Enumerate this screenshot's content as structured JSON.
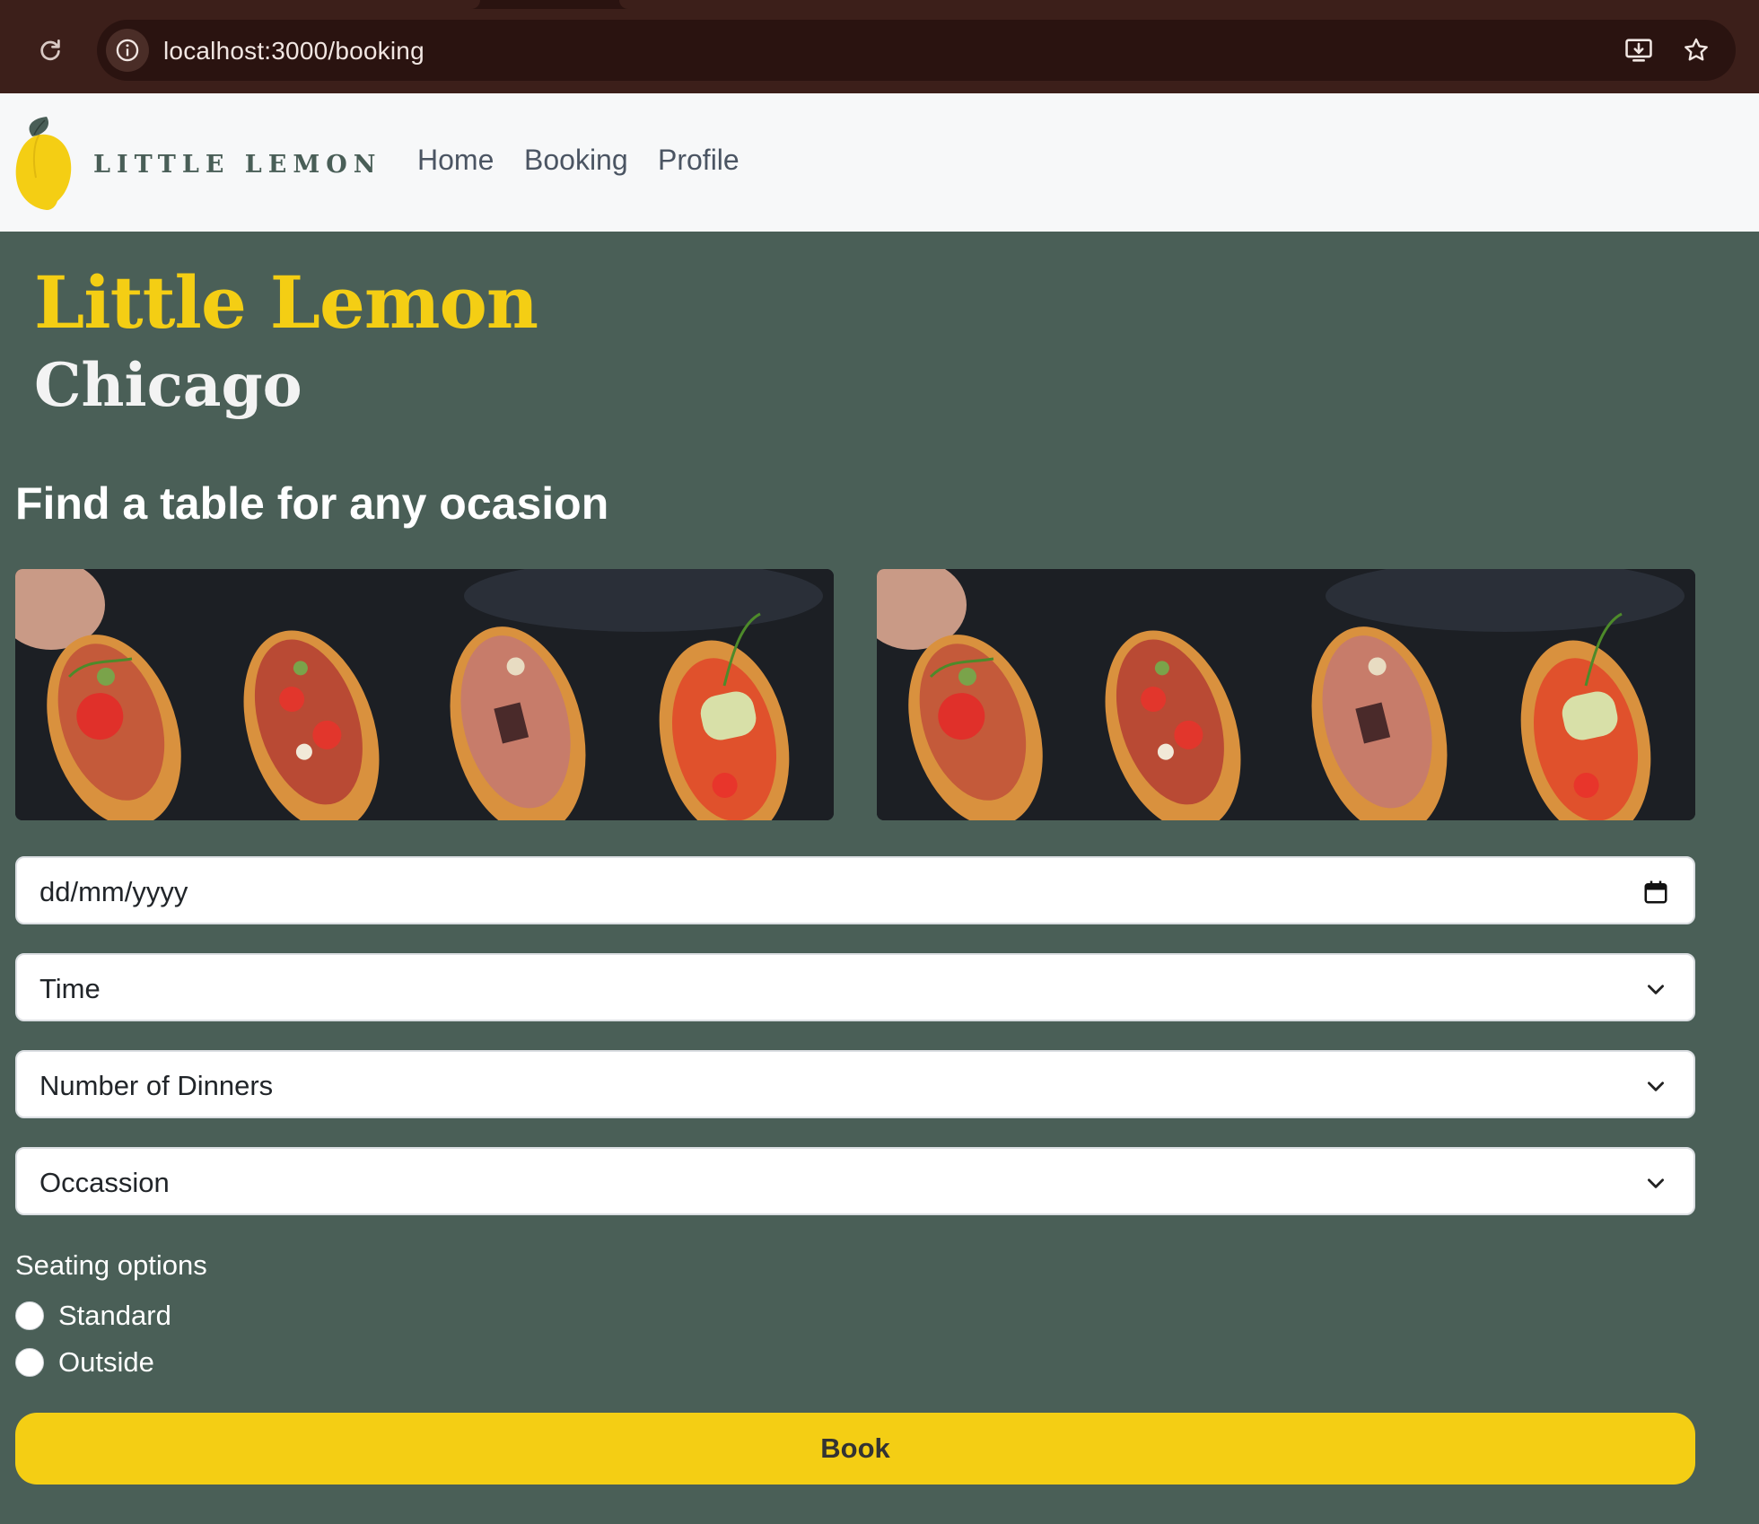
{
  "browser": {
    "url": "localhost:3000/booking",
    "icons": [
      "reload-icon",
      "site-info-icon",
      "install-app-icon",
      "bookmark-star-icon"
    ]
  },
  "nav": {
    "logo_text": "LITTLE LEMON",
    "links": [
      "Home",
      "Booking",
      "Profile"
    ]
  },
  "hero": {
    "title": "Little Lemon",
    "subtitle": "Chicago"
  },
  "booking": {
    "heading": "Find a table for any ocasion",
    "date_placeholder": "dd/mm/yyyy",
    "time_label": "Time",
    "diners_label": "Number of Dinners",
    "occasion_label": "Occassion",
    "seating_legend": "Seating options",
    "seating_options": [
      "Standard",
      "Outside"
    ],
    "book_label": "Book"
  },
  "colors": {
    "brand_green": "#495e57",
    "brand_yellow": "#f4ce14",
    "chrome": "#3c1f1a"
  }
}
